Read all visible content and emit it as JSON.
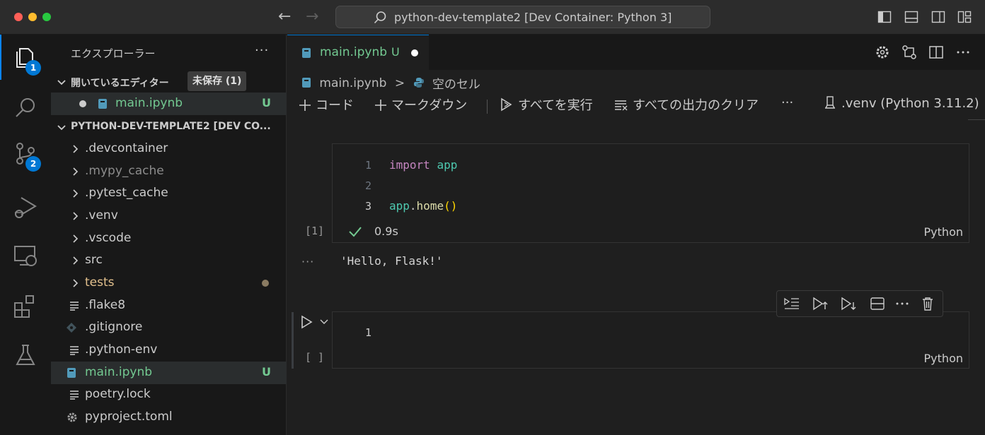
{
  "window": {
    "search_text": "python-dev-template2 [Dev Container: Python 3]"
  },
  "activity_bar": {
    "explorer_badge": "1",
    "scm_badge": "2"
  },
  "sidebar": {
    "title": "エクスプローラー",
    "more": "···",
    "open_editors": {
      "label": "開いているエディター",
      "unsaved_badge": "未保存 (1)",
      "items": [
        {
          "name": "main.ipynb",
          "status": "U"
        }
      ]
    },
    "project": {
      "label": "PYTHON-DEV-TEMPLATE2 [DEV CO...",
      "items": [
        {
          "name": ".devcontainer",
          "type": "folder"
        },
        {
          "name": ".mypy_cache",
          "type": "folder"
        },
        {
          "name": ".pytest_cache",
          "type": "folder"
        },
        {
          "name": ".venv",
          "type": "folder"
        },
        {
          "name": ".vscode",
          "type": "folder"
        },
        {
          "name": "src",
          "type": "folder"
        },
        {
          "name": "tests",
          "type": "folder"
        },
        {
          "name": ".flake8",
          "type": "file"
        },
        {
          "name": ".gitignore",
          "type": "file"
        },
        {
          "name": ".python-env",
          "type": "file"
        },
        {
          "name": "main.ipynb",
          "type": "file",
          "status": "U"
        },
        {
          "name": "poetry.lock",
          "type": "file"
        },
        {
          "name": "pyproject.toml",
          "type": "file"
        }
      ]
    }
  },
  "editor": {
    "tab": {
      "label": "main.ipynb",
      "status": "U"
    },
    "breadcrumb": {
      "file": "main.ipynb",
      "separator": ">",
      "cell": "空のセル"
    },
    "toolbar": {
      "add_code": "コード",
      "add_markdown": "マークダウン",
      "run_all": "すべてを実行",
      "clear_outputs": "すべての出力のクリア",
      "more": "···",
      "kernel": ".venv (Python 3.11.2)"
    },
    "cells": [
      {
        "line_numbers": [
          "1",
          "2",
          "3"
        ],
        "code": {
          "l1_kw": "import",
          "l1_id": "app",
          "l3_obj": "app",
          "l3_dot": ".",
          "l3_fn": "home",
          "l3_paren": "()"
        },
        "exec_count": "[1]",
        "duration": "0.9s",
        "language": "Python",
        "output_more": "···",
        "output": "'Hello, Flask!'"
      },
      {
        "line_numbers": [
          "1"
        ],
        "exec_count": "[ ]",
        "language": "Python"
      }
    ]
  },
  "colors": {
    "accent": "#0078d4",
    "untracked": "#73c991",
    "success": "#73c991"
  }
}
